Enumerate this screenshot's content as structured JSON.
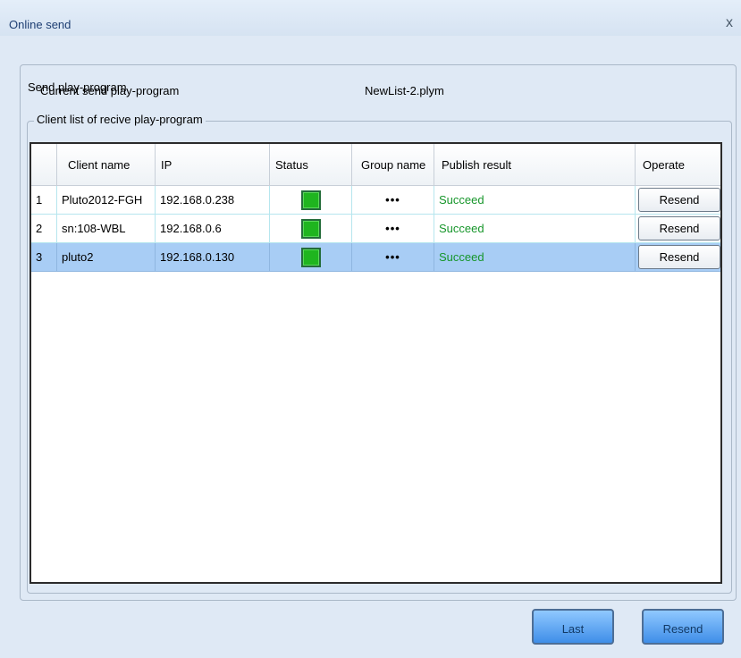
{
  "window": {
    "title": "Online send",
    "close_glyph": "x"
  },
  "send_group": {
    "legend": "Send play-program",
    "current_label": "Current send play-program",
    "current_value": "NewList-2.plym"
  },
  "client_group": {
    "legend": "Client list of recive play-program"
  },
  "table": {
    "headers": [
      "",
      "Client name",
      "IP",
      "Status",
      "Group name",
      "Publish result",
      "Operate"
    ],
    "rows": [
      {
        "index": "1",
        "client_name": "Pluto2012-FGH",
        "ip": "192.168.0.238",
        "status": "online",
        "group": "•••",
        "result": "Succeed",
        "operate": "Resend",
        "selected": false
      },
      {
        "index": "2",
        "client_name": "sn:108-WBL",
        "ip": "192.168.0.6",
        "status": "online",
        "group": "•••",
        "result": "Succeed",
        "operate": "Resend",
        "selected": false
      },
      {
        "index": "3",
        "client_name": "pluto2",
        "ip": "192.168.0.130",
        "status": "online",
        "group": "•••",
        "result": "Succeed",
        "operate": "Resend",
        "selected": true
      }
    ]
  },
  "buttons": {
    "last": "Last",
    "resend": "Resend"
  },
  "colors": {
    "status_online": "#1fb51f",
    "succeed_text": "#17962b",
    "selected_row": "#a8cdf5"
  }
}
